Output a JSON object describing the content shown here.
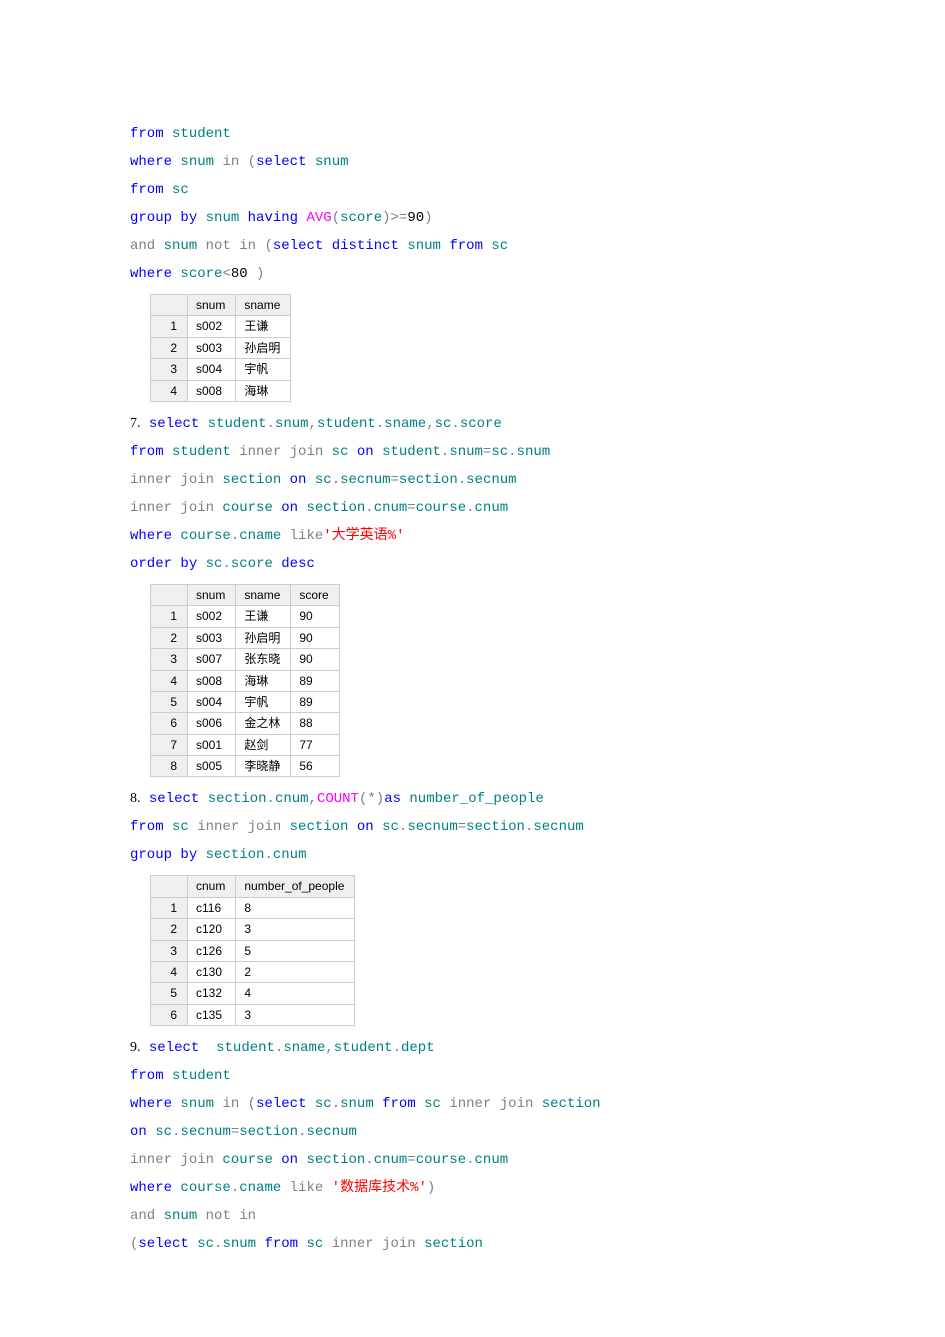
{
  "code1": {
    "l1a": "from",
    "l1b": " student",
    "l2a": "where",
    "l2b": " snum ",
    "l2c": "in",
    "l2d": " (",
    "l2e": "select",
    "l2f": " snum",
    "l3a": "from",
    "l3b": " sc",
    "l4a": "group",
    "l4b": " by",
    "l4c": " snum ",
    "l4d": "having",
    "l4e": " AVG",
    "l4f": "(",
    "l4g": "score",
    "l4h": ")>=",
    "l4i": "90",
    "l4j": ")",
    "l5a": "and",
    "l5b": " snum ",
    "l5c": "not",
    "l5d": " in",
    "l5e": " (",
    "l5f": "select",
    "l5g": " distinct",
    "l5h": " snum ",
    "l5i": "from",
    "l5j": " sc",
    "l6a": "where",
    "l6b": " score",
    "l6c": "<",
    "l6d": "80",
    "l6e": " )"
  },
  "table1": {
    "headers": [
      "",
      "snum",
      "sname"
    ],
    "rows": [
      [
        "1",
        "s002",
        "王谦"
      ],
      [
        "2",
        "s003",
        "孙启明"
      ],
      [
        "3",
        "s004",
        "宇帆"
      ],
      [
        "4",
        "s008",
        "海琳"
      ]
    ]
  },
  "code2": {
    "num": "7.",
    "l1a": " select",
    "l1b": " student",
    "l1c": ".",
    "l1d": "snum",
    "l1e": ",",
    "l1f": "student",
    "l1g": ".",
    "l1h": "sname",
    "l1i": ",",
    "l1j": "sc",
    "l1k": ".",
    "l1l": "score",
    "l2a": "from",
    "l2b": " student ",
    "l2c": "inner",
    "l2d": " join",
    "l2e": " sc ",
    "l2f": "on",
    "l2g": " student",
    "l2h": ".",
    "l2i": "snum",
    "l2j": "=",
    "l2k": "sc",
    "l2l": ".",
    "l2m": "snum",
    "l3a": "inner",
    "l3b": " join",
    "l3c": " section",
    "l3d": " on",
    "l3e": " sc",
    "l3f": ".",
    "l3g": "secnum",
    "l3h": "=",
    "l3i": "section",
    "l3j": ".",
    "l3k": "secnum",
    "l4a": "inner",
    "l4b": " join",
    "l4c": " course ",
    "l4d": "on",
    "l4e": " section",
    "l4f": ".",
    "l4g": "cnum",
    "l4h": "=",
    "l4i": "course",
    "l4j": ".",
    "l4k": "cnum",
    "l5a": "where",
    "l5b": " course",
    "l5c": ".",
    "l5d": "cname ",
    "l5e": "like",
    "l5f": "'大学英语%'",
    "l6a": "order",
    "l6b": " by",
    "l6c": " sc",
    "l6d": ".",
    "l6e": "score ",
    "l6f": "desc"
  },
  "table2": {
    "headers": [
      "",
      "snum",
      "sname",
      "score"
    ],
    "rows": [
      [
        "1",
        "s002",
        "王谦",
        "90"
      ],
      [
        "2",
        "s003",
        "孙启明",
        "90"
      ],
      [
        "3",
        "s007",
        "张东晓",
        "90"
      ],
      [
        "4",
        "s008",
        "海琳",
        "89"
      ],
      [
        "5",
        "s004",
        "宇帆",
        "89"
      ],
      [
        "6",
        "s006",
        "金之林",
        "88"
      ],
      [
        "7",
        "s001",
        "赵剑",
        "77"
      ],
      [
        "8",
        "s005",
        "李晓静",
        "56"
      ]
    ]
  },
  "code3": {
    "num": "8.",
    "l1a": " select",
    "l1b": " section",
    "l1c": ".",
    "l1d": "cnum",
    "l1e": ",",
    "l1f": "COUNT",
    "l1g": "(*)",
    "l1h": "as",
    "l1i": " number_of_people",
    "l2a": "from",
    "l2b": " sc ",
    "l2c": "inner",
    "l2d": " join",
    "l2e": " section",
    "l2f": " on",
    "l2g": " sc",
    "l2h": ".",
    "l2i": "secnum",
    "l2j": "=",
    "l2k": "section",
    "l2l": ".",
    "l2m": "secnum",
    "l3a": "group",
    "l3b": " by",
    "l3c": " section",
    "l3d": ".",
    "l3e": "cnum"
  },
  "table3": {
    "headers": [
      "",
      "cnum",
      "number_of_people"
    ],
    "rows": [
      [
        "1",
        "c116",
        "8"
      ],
      [
        "2",
        "c120",
        "3"
      ],
      [
        "3",
        "c126",
        "5"
      ],
      [
        "4",
        "c130",
        "2"
      ],
      [
        "5",
        "c132",
        "4"
      ],
      [
        "6",
        "c135",
        "3"
      ]
    ]
  },
  "code4": {
    "num": "9.",
    "l1a": " select",
    "l1b": "  student",
    "l1c": ".",
    "l1d": "sname",
    "l1e": ",",
    "l1f": "student",
    "l1g": ".",
    "l1h": "dept",
    "l2a": "from",
    "l2b": " student",
    "l3a": "where",
    "l3b": " snum ",
    "l3c": "in",
    "l3d": " (",
    "l3e": "select",
    "l3f": " sc",
    "l3g": ".",
    "l3h": "snum ",
    "l3i": "from",
    "l3j": " sc ",
    "l3k": "inner",
    "l3l": " join",
    "l3m": " section",
    "l4a": "on",
    "l4b": " sc",
    "l4c": ".",
    "l4d": "secnum",
    "l4e": "=",
    "l4f": "section",
    "l4g": ".",
    "l4h": "secnum",
    "l5a": "inner",
    "l5b": " join",
    "l5c": " course ",
    "l5d": "on",
    "l5e": " section",
    "l5f": ".",
    "l5g": "cnum",
    "l5h": "=",
    "l5i": "course",
    "l5j": ".",
    "l5k": "cnum",
    "l6a": "where",
    "l6b": " course",
    "l6c": ".",
    "l6d": "cname ",
    "l6e": "like",
    "l6f": " '数据库技术%'",
    "l6g": ")",
    "l7a": "and",
    "l7b": " snum ",
    "l7c": "not",
    "l7d": " in",
    "l8a": "(",
    "l8b": "select",
    "l8c": " sc",
    "l8d": ".",
    "l8e": "snum ",
    "l8f": "from",
    "l8g": " sc ",
    "l8h": "inner",
    "l8i": " join",
    "l8j": " section"
  }
}
